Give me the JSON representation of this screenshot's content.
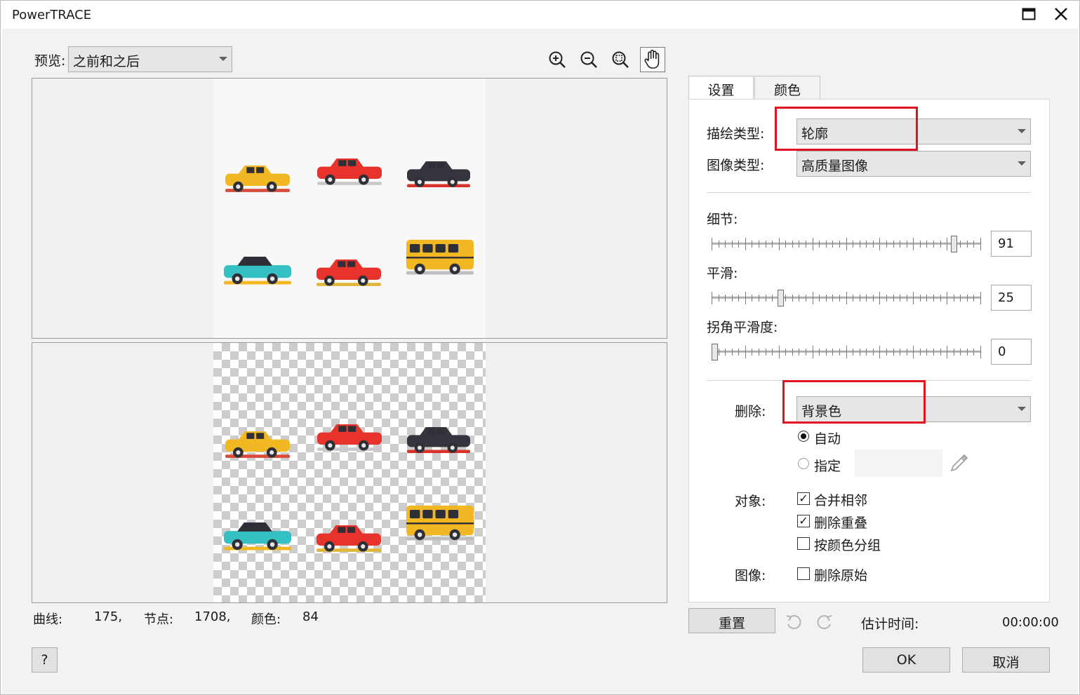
{
  "window": {
    "title": "PowerTRACE"
  },
  "preview": {
    "label": "预览:",
    "mode": "之前和之后",
    "tools": [
      "zoom-in-icon",
      "zoom-out-icon",
      "zoom-fit-icon",
      "pan-hand-icon"
    ]
  },
  "tabs": [
    {
      "label": "设置"
    },
    {
      "label": "颜色"
    }
  ],
  "settings": {
    "trace_type_label": "描绘类型:",
    "trace_type_value": "轮廓",
    "image_type_label": "图像类型:",
    "image_type_value": "高质量图像",
    "detail_label": "细节:",
    "detail_value": "91",
    "smooth_label": "平滑:",
    "smooth_value": "25",
    "corner_label": "拐角平滑度:",
    "corner_value": "0",
    "remove_label": "删除:",
    "remove_value": "背景色",
    "auto_label": "自动",
    "specify_label": "指定",
    "objects_label": "对象:",
    "merge_label": "合并相邻",
    "remove_overlap_label": "删除重叠",
    "group_by_color_label": "按颜色分组",
    "image_label": "图像:",
    "delete_original_label": "删除原始"
  },
  "stats": {
    "curves_label": "曲线:",
    "curves_value": "175,",
    "nodes_label": "节点:",
    "nodes_value": "1708,",
    "colors_label": "颜色:",
    "colors_value": "84"
  },
  "footer": {
    "reset_label": "重置",
    "est_time_label": "估计时间:",
    "est_time_value": "00:00:00",
    "ok_label": "OK",
    "cancel_label": "取消",
    "help_label": "?"
  },
  "cars": [
    {
      "name": "yellow-sports-car",
      "body": "#f2b824",
      "roof": "#f2b824",
      "shadow": "#d94a3a"
    },
    {
      "name": "red-pickup-truck",
      "body": "#e8322c",
      "roof": "#e8322c",
      "shadow": "#c9c9c9"
    },
    {
      "name": "black-hotrod",
      "body": "#35353d",
      "roof": "#35353d",
      "shadow": "#d9322c"
    },
    {
      "name": "teal-classic-car",
      "body": "#35c1c3",
      "roof": "#2f2f37",
      "shadow": "#f2b824"
    },
    {
      "name": "red-convertible",
      "body": "#e8322c",
      "roof": "#e8322c",
      "shadow": "#e0b53a"
    },
    {
      "name": "yellow-school-bus",
      "body": "#f2b824",
      "roof": "#f2b824",
      "shadow": "#bdbdbd"
    }
  ]
}
